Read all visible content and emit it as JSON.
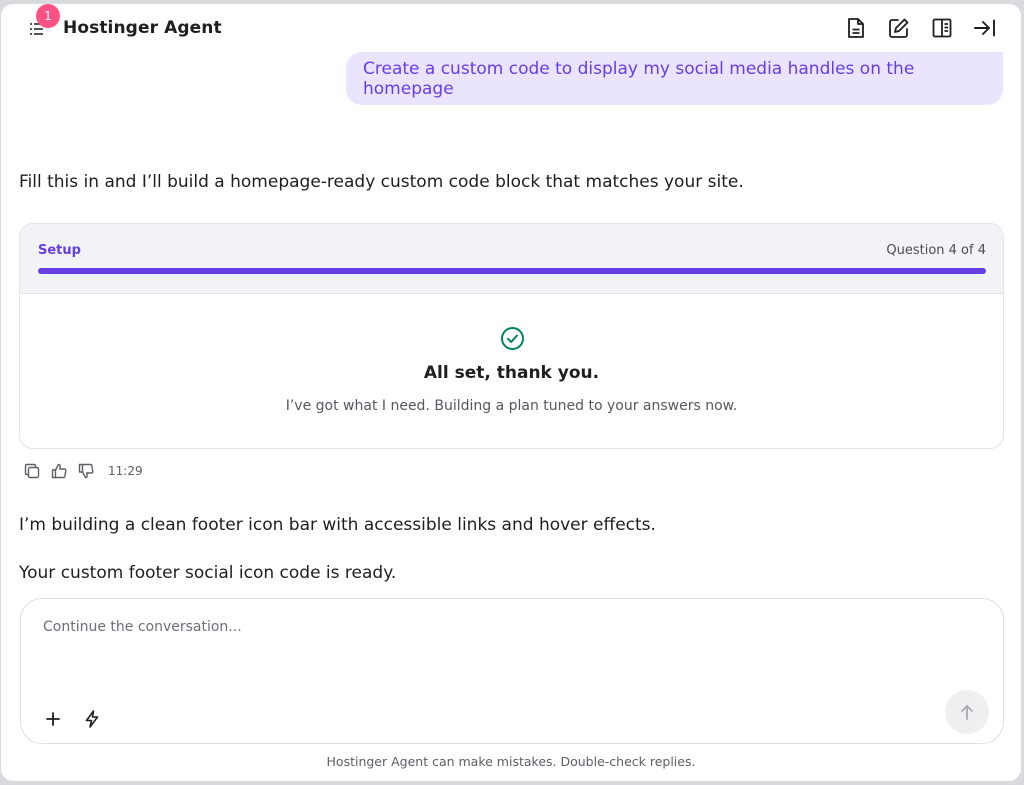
{
  "header": {
    "title": "Hostinger Agent",
    "notification_count": "1",
    "icons": [
      "list-icon",
      "document-icon",
      "edit-icon",
      "book-icon",
      "collapse-right-icon"
    ]
  },
  "user_message": "Create a custom code to display my social media handles on the homepage",
  "assistant": {
    "intro": "Fill this in and I’ll build a homepage-ready custom code block that matches your site.",
    "card": {
      "label": "Setup",
      "question_count": "Question 4 of 4",
      "progress_fraction": 1.0,
      "done_title": "All set, thank you.",
      "done_subtitle": "I’ve got what I need. Building a plan tuned to your answers now."
    },
    "timestamp": "11:29",
    "message_1": "I’m building a clean footer icon bar with accessible links and hover effects.",
    "message_2": "Your custom footer social icon code is ready."
  },
  "composer": {
    "placeholder": "Continue the conversation..."
  },
  "disclaimer": "Hostinger Agent can make mistakes. Double-check replies.",
  "colors": {
    "accent": "#673de6",
    "user_bubble": "#ebe4ff",
    "badge": "#fc5185",
    "success": "#008361"
  }
}
